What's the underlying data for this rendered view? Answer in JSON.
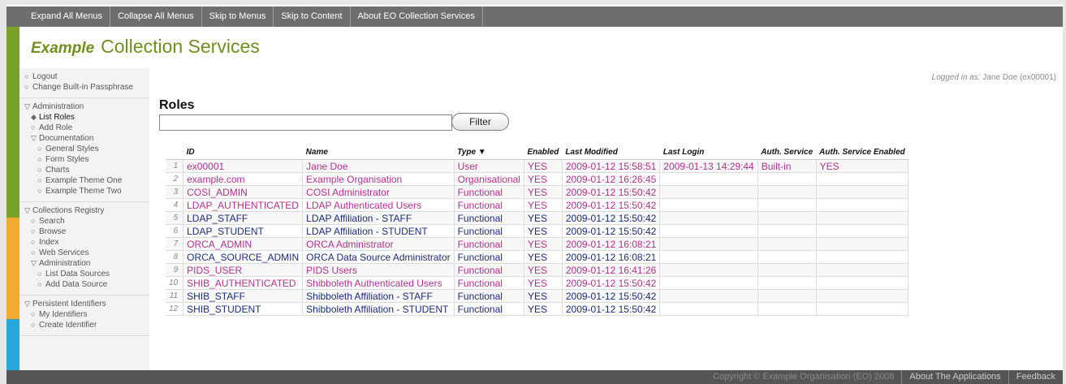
{
  "topnav": [
    "Expand All Menus",
    "Collapse All Menus",
    "Skip to Menus",
    "Skip to Content",
    "About EO Collection Services"
  ],
  "brand": {
    "prefix": "Example",
    "title": "Collection Services"
  },
  "logged_in": {
    "label": "Logged in as:",
    "user": "Jane Doe (ex00001)"
  },
  "sidebar": {
    "logout": "Logout",
    "change_pass": "Change Built-in Passphrase",
    "administration": "Administration",
    "list_roles": "List Roles",
    "add_role": "Add Role",
    "documentation": "Documentation",
    "doc_items": [
      "General Styles",
      "Form Styles",
      "Charts",
      "Example Theme One",
      "Example Theme Two"
    ],
    "collections_registry": "Collections Registry",
    "cr_items": [
      "Search",
      "Browse",
      "Index",
      "Web Services"
    ],
    "cr_admin": "Administration",
    "cr_admin_items": [
      "List Data Sources",
      "Add Data Source"
    ],
    "persistent_identifiers": "Persistent Identifiers",
    "pi_items": [
      "My Identifiers",
      "Create Identifier"
    ]
  },
  "page": {
    "title": "Roles",
    "filter_value": "",
    "filter_button": "Filter"
  },
  "table": {
    "headers": [
      "ID",
      "Name",
      "Type ▼",
      "Enabled",
      "Last Modified",
      "Last Login",
      "Auth. Service",
      "Auth. Service Enabled"
    ],
    "rows": [
      {
        "n": "1",
        "id": "ex00001",
        "name": "Jane Doe",
        "type": "User",
        "enabled": "YES",
        "modified": "2009-01-12 15:58:51",
        "login": "2009-01-13 14:29:44",
        "auth": "Built-in",
        "auth_en": "YES",
        "style": "pink"
      },
      {
        "n": "2",
        "id": "example.com",
        "name": "Example Organisation",
        "type": "Organisational",
        "enabled": "YES",
        "modified": "2009-01-12 16:26:45",
        "login": "",
        "auth": "",
        "auth_en": "",
        "style": "pink"
      },
      {
        "n": "3",
        "id": "COSI_ADMIN",
        "name": "COSI Administrator",
        "type": "Functional",
        "enabled": "YES",
        "modified": "2009-01-12 15:50:42",
        "login": "",
        "auth": "",
        "auth_en": "",
        "style": "pink"
      },
      {
        "n": "4",
        "id": "LDAP_AUTHENTICATED",
        "name": "LDAP Authenticated Users",
        "type": "Functional",
        "enabled": "YES",
        "modified": "2009-01-12 15:50:42",
        "login": "",
        "auth": "",
        "auth_en": "",
        "style": "pink"
      },
      {
        "n": "5",
        "id": "LDAP_STAFF",
        "name": "LDAP Affiliation - STAFF",
        "type": "Functional",
        "enabled": "YES",
        "modified": "2009-01-12 15:50:42",
        "login": "",
        "auth": "",
        "auth_en": "",
        "style": "navy"
      },
      {
        "n": "6",
        "id": "LDAP_STUDENT",
        "name": "LDAP Affiliation - STUDENT",
        "type": "Functional",
        "enabled": "YES",
        "modified": "2009-01-12 15:50:42",
        "login": "",
        "auth": "",
        "auth_en": "",
        "style": "navy"
      },
      {
        "n": "7",
        "id": "ORCA_ADMIN",
        "name": "ORCA Administrator",
        "type": "Functional",
        "enabled": "YES",
        "modified": "2009-01-12 16:08:21",
        "login": "",
        "auth": "",
        "auth_en": "",
        "style": "pink"
      },
      {
        "n": "8",
        "id": "ORCA_SOURCE_ADMIN",
        "name": "ORCA Data Source Administrator",
        "type": "Functional",
        "enabled": "YES",
        "modified": "2009-01-12 16:08:21",
        "login": "",
        "auth": "",
        "auth_en": "",
        "style": "navy"
      },
      {
        "n": "9",
        "id": "PIDS_USER",
        "name": "PIDS Users",
        "type": "Functional",
        "enabled": "YES",
        "modified": "2009-01-12 16:41:26",
        "login": "",
        "auth": "",
        "auth_en": "",
        "style": "pink"
      },
      {
        "n": "10",
        "id": "SHIB_AUTHENTICATED",
        "name": "Shibboleth Authenticated Users",
        "type": "Functional",
        "enabled": "YES",
        "modified": "2009-01-12 15:50:42",
        "login": "",
        "auth": "",
        "auth_en": "",
        "style": "pink"
      },
      {
        "n": "11",
        "id": "SHIB_STAFF",
        "name": "Shibboleth Affiliation - STAFF",
        "type": "Functional",
        "enabled": "YES",
        "modified": "2009-01-12 15:50:42",
        "login": "",
        "auth": "",
        "auth_en": "",
        "style": "navy"
      },
      {
        "n": "12",
        "id": "SHIB_STUDENT",
        "name": "Shibboleth Affiliation - STUDENT",
        "type": "Functional",
        "enabled": "YES",
        "modified": "2009-01-12 15:50:42",
        "login": "",
        "auth": "",
        "auth_en": "",
        "style": "navy"
      }
    ]
  },
  "footer": {
    "copyright": "Copyright © Example Organisation (EO) 2008",
    "about": "About The Applications",
    "feedback": "Feedback"
  },
  "colors": {
    "green": "#7aa127",
    "orange": "#f1ac2f",
    "blue": "#25a7dc",
    "pink_text": "#b0308e",
    "navy_text": "#1c2c7a"
  }
}
